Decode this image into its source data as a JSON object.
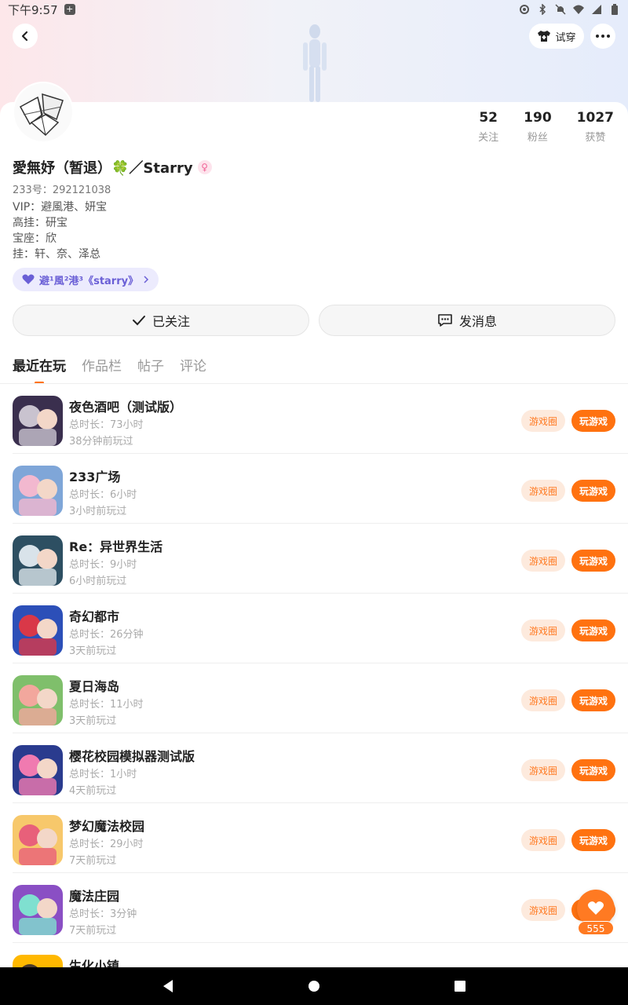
{
  "status_bar": {
    "time": "下午9:57"
  },
  "header": {
    "tryon_label": "试穿"
  },
  "profile": {
    "nickname": "愛無妤（暂退）🍀／Starry",
    "gender_symbol": "♀",
    "uid": "233号：292121038",
    "bio": [
      "VIP：避風港、妍宝",
      "高挂：研宝",
      "宝座：欣",
      "挂：轩、奈、泽总"
    ],
    "club_label": "避¹風²港³《starry》",
    "stats": [
      {
        "num": "52",
        "label": "关注"
      },
      {
        "num": "190",
        "label": "粉丝"
      },
      {
        "num": "1027",
        "label": "获赞"
      }
    ]
  },
  "actions": {
    "follow_label": "已关注",
    "message_label": "发消息"
  },
  "tabs": [
    "最近在玩",
    "作品栏",
    "帖子",
    "评论"
  ],
  "game_buttons": {
    "circle": "游戏圈",
    "play": "玩游戏"
  },
  "games": [
    {
      "name": "夜色酒吧（测试版）",
      "duration": "总时长：73小时",
      "last": "38分钟前玩过",
      "colors": [
        "#3a2f4e",
        "#c9c3cf"
      ]
    },
    {
      "name": "233广场",
      "duration": "总时长：6小时",
      "last": "3小时前玩过",
      "colors": [
        "#7fa6d8",
        "#f2b8cf"
      ]
    },
    {
      "name": "Re：异世界生活",
      "duration": "总时长：9小时",
      "last": "6小时前玩过",
      "colors": [
        "#2d4f62",
        "#d9e3ea"
      ]
    },
    {
      "name": "奇幻都市",
      "duration": "总时长：26分钟",
      "last": "3天前玩过",
      "colors": [
        "#2c4fb8",
        "#d93848"
      ]
    },
    {
      "name": "夏日海岛",
      "duration": "总时长：11小时",
      "last": "3天前玩过",
      "colors": [
        "#7fbf6b",
        "#f2a79d"
      ]
    },
    {
      "name": "樱花校园模拟器测试版",
      "duration": "总时长：1小时",
      "last": "4天前玩过",
      "colors": [
        "#2a3b8e",
        "#f07ab0"
      ]
    },
    {
      "name": "梦幻魔法校园",
      "duration": "总时长：29小时",
      "last": "7天前玩过",
      "colors": [
        "#f7c86b",
        "#e8607a"
      ]
    },
    {
      "name": "魔法庄园",
      "duration": "总时长：3分钟",
      "last": "7天前玩过",
      "colors": [
        "#8a4fc4",
        "#7fe0d0"
      ]
    },
    {
      "name": "生化小镇",
      "duration": "",
      "last": "",
      "colors": [
        "#ffb800",
        "#4a3a2a"
      ]
    }
  ],
  "like_count": "555"
}
